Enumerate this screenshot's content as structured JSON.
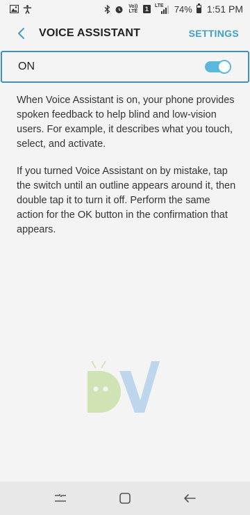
{
  "status_bar": {
    "icons_left": [
      "image-icon",
      "accessibility-icon"
    ],
    "icons_right": [
      "bluetooth-icon",
      "alarm-icon",
      "volte-icon",
      "sim-icon",
      "lte-signal-icon",
      "battery-icon"
    ],
    "volte_text": "Vo)) LTE",
    "sim_text": "1",
    "lte_text": "LTE",
    "battery": "74%",
    "time": "1:51 PM"
  },
  "header": {
    "title": "VOICE ASSISTANT",
    "settings_label": "SETTINGS",
    "accent_color": "#3ea0c4"
  },
  "toggle": {
    "label": "ON",
    "state": "on",
    "color": "#5ab8dd"
  },
  "description": {
    "paragraph_1": "When Voice Assistant is on, your phone provides spoken feedback to help blind and low-vision users. For example, it describes what you touch, select, and activate.",
    "paragraph_2": "If you turned Voice Assistant on by mistake, tap the switch until an outline appears around it, then double tap it to turn it off. Perform the same action for the OK button in the confirmation that appears."
  },
  "nav_bar": {
    "buttons": [
      "recents-icon",
      "home-icon",
      "back-icon"
    ]
  }
}
